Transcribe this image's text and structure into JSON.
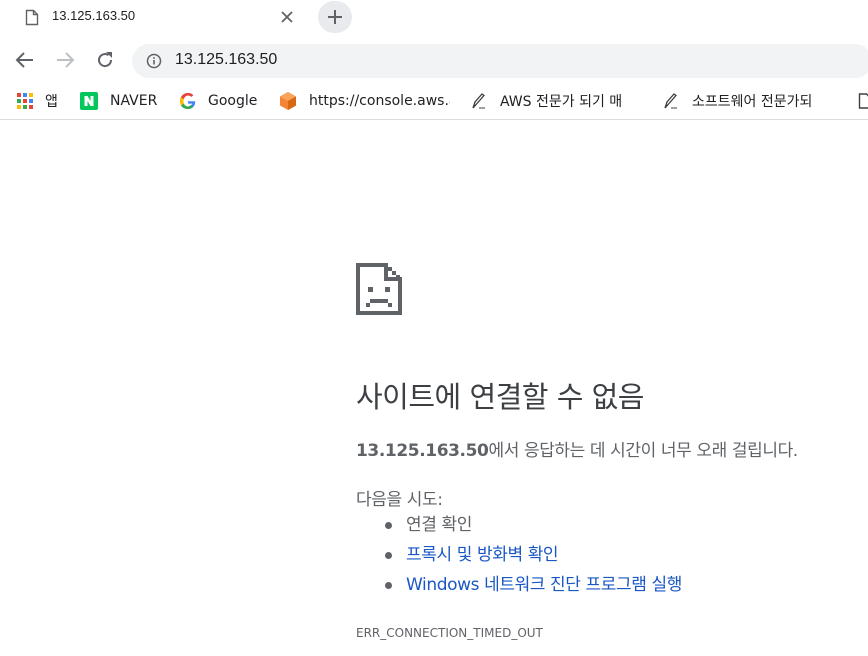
{
  "tab": {
    "title": "13.125.163.50",
    "favicon": "page-icon"
  },
  "toolbar": {
    "back_icon": "back-arrow-icon",
    "forward_icon": "forward-arrow-icon",
    "reload_icon": "reload-icon",
    "url": "13.125.163.50",
    "info_icon": "info-icon"
  },
  "bookmarks": [
    {
      "label": "앱",
      "icon": "apps-grid-icon"
    },
    {
      "label": "NAVER",
      "icon": "naver-icon"
    },
    {
      "label": "Google",
      "icon": "google-icon"
    },
    {
      "label": "https://console.aws.a",
      "icon": "aws-icon"
    },
    {
      "label": "AWS 전문가 되기 매",
      "icon": "pen-icon"
    },
    {
      "label": "소프트웨어 전문가되",
      "icon": "pen-icon"
    }
  ],
  "error": {
    "icon": "sad-page-icon",
    "heading": "사이트에 연결할 수 없음",
    "host": "13.125.163.50",
    "description_suffix": "에서 응답하는 데 시간이 너무 오래 걸립니다.",
    "try_label": "다음을 시도:",
    "suggestions": [
      {
        "text": "연결 확인",
        "link": false
      },
      {
        "text": "프록시 및 방화벽 확인",
        "link": true
      },
      {
        "text": "Windows 네트워크 진단 프로그램 실행",
        "link": true
      }
    ],
    "code": "ERR_CONNECTION_TIMED_OUT"
  },
  "colors": {
    "link": "#1a57c5",
    "text": "#5f6368",
    "heading": "#3c4043",
    "omnibox_bg": "#f1f3f4"
  }
}
